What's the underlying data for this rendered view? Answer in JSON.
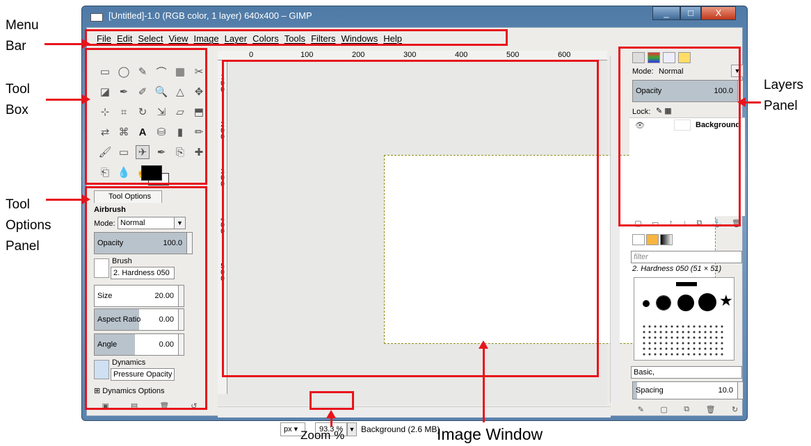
{
  "annotations": {
    "menu_bar": "Menu Bar",
    "tool_box": "Tool Box",
    "tool_options": "Tool Options Panel",
    "layers_panel": "Layers Panel",
    "zoom": "Zoom %",
    "image_window": "Image Window",
    "menu_bar_lines": [
      "Menu",
      "Bar"
    ],
    "tool_box_lines": [
      "Tool",
      "Box"
    ],
    "tool_options_lines": [
      "Tool",
      "Options",
      "Panel"
    ],
    "layers_panel_lines": [
      "Layers",
      "Panel"
    ]
  },
  "window": {
    "title": "[Untitled]-1.0 (RGB color, 1 layer) 640x400 – GIMP",
    "minimize": "_",
    "maximize": "□",
    "close": "X"
  },
  "menu": [
    "File",
    "Edit",
    "Select",
    "View",
    "Image",
    "Layer",
    "Colors",
    "Tools",
    "Filters",
    "Windows",
    "Help"
  ],
  "tools": [
    "rect-select",
    "ellipse-select",
    "free-select",
    "fuzzy-select",
    "color-select",
    "scissors",
    "foreground-select",
    "paths",
    "color-picker",
    "zoom",
    "measure",
    "move",
    "align",
    "crop",
    "rotate",
    "scale",
    "shear",
    "perspective",
    "flip",
    "cage",
    "text",
    "bucket-fill",
    "blend",
    "pencil",
    "paintbrush",
    "eraser",
    "airbrush",
    "ink",
    "clone",
    "heal",
    "perspective-clone",
    "blur",
    "smudge",
    "dodge"
  ],
  "tool_options": {
    "tab": "Tool Options",
    "tool_name": "Airbrush",
    "mode_label": "Mode:",
    "mode_value": "Normal",
    "opacity_label": "Opacity",
    "opacity_value": "100.0",
    "brush_label": "Brush",
    "brush_value": "2. Hardness 050",
    "size_label": "Size",
    "size_value": "20.00",
    "aspect_label": "Aspect Ratio",
    "aspect_value": "0.00",
    "angle_label": "Angle",
    "angle_value": "0.00",
    "dynamics_label": "Dynamics",
    "dynamics_value": "Pressure Opacity",
    "dynamics_options": "Dynamics Options"
  },
  "rulers": {
    "h": [
      "0",
      "100",
      "200",
      "300",
      "400",
      "500",
      "600"
    ],
    "v": [
      "100",
      "200",
      "300",
      "400",
      "500"
    ]
  },
  "status": {
    "unit": "px",
    "zoom": "93.3 %",
    "text": "Background (2.6 MB)"
  },
  "layers": {
    "mode_label": "Mode:",
    "mode_value": "Normal",
    "opacity_label": "Opacity",
    "opacity_value": "100.0",
    "lock_label": "Lock:",
    "layer_name": "Background"
  },
  "brushes": {
    "filter_placeholder": "filter",
    "selected": "2. Hardness 050 (51 × 51)",
    "preset": "Basic,",
    "spacing_label": "Spacing",
    "spacing_value": "10.0"
  },
  "colors": {
    "annotation_red": "#e8141c",
    "slider_fill": "#b9c3cc",
    "window_frame": "#5b83ad"
  }
}
